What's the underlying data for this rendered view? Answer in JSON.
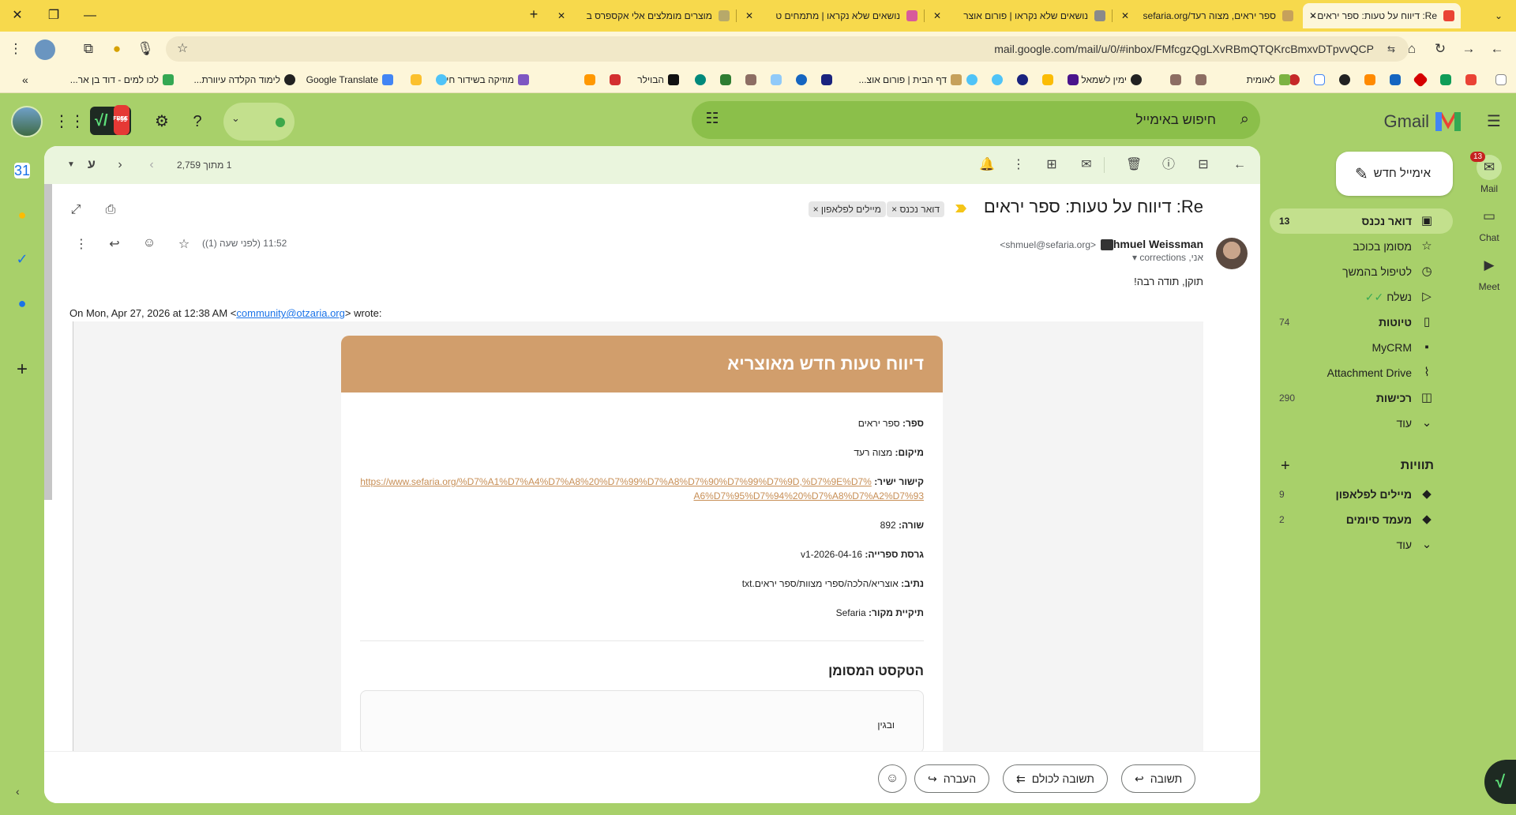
{
  "browser": {
    "tabs": [
      {
        "title": "Re: דיווח על טעות: ספר יראים -",
        "active": true
      },
      {
        "title": "ספר יראים, מצוה רעד/sefaria.org",
        "active": false
      },
      {
        "title": "נושאים שלא נקראו | פורום אוצר",
        "active": false
      },
      {
        "title": "נושאים שלא נקראו | מתמחים ט",
        "active": false
      },
      {
        "title": "מוצרים מומלצים אלי אקספרס ב",
        "active": false
      }
    ],
    "url": "mail.google.com/mail/u/0/#inbox/FMfcgzQgLXvRBmQTQKrcBmxvDTpvvQCP",
    "bookmarks": [
      {
        "label": "לאומית"
      },
      {
        "label": "ימין לשמאל"
      },
      {
        "label": "דף הבית | פורום אוצ..."
      },
      {
        "label": "הבוילר"
      },
      {
        "label": "מוזיקה בשידור חי"
      },
      {
        "label": "Google Translate"
      },
      {
        "label": "לימוד הקלדה עיוורת..."
      },
      {
        "label": "לכו למים - דוד בן אר..."
      }
    ]
  },
  "gmail": {
    "logo_text": "Gmail",
    "search_placeholder": "חיפוש באימייל",
    "extension_badge": "+99",
    "extension_free": "FREE",
    "compose_label": "אימייל חדש",
    "nav": [
      {
        "label": "דואר נכנס",
        "count": "13",
        "icon": "inbox-icon",
        "active": true
      },
      {
        "label": "מסומן בכוכב",
        "count": "",
        "icon": "star-icon"
      },
      {
        "label": "לטיפול בהמשך",
        "count": "",
        "icon": "clock-icon"
      },
      {
        "label": "נשלח",
        "count": "",
        "icon": "send-icon"
      },
      {
        "label": "טיוטות",
        "count": "74",
        "icon": "draft-icon",
        "bold": true
      },
      {
        "label": "MyCRM",
        "count": "",
        "icon": "contact-card-icon"
      },
      {
        "label": "Attachment Drive",
        "count": "",
        "icon": "paperclip-icon"
      },
      {
        "label": "רכישות",
        "count": "290",
        "icon": "shopping-bag-icon",
        "bold": true
      },
      {
        "label": "עוד",
        "count": "",
        "icon": "chevron-down-icon"
      }
    ],
    "labels_heading": "תוויות",
    "labels": [
      {
        "label": "מיילים לפלאפון",
        "count": "9"
      },
      {
        "label": "מעמד סיומים",
        "count": "2"
      },
      {
        "label": "עוד",
        "count": ""
      }
    ],
    "rail": {
      "mail_label": "Mail",
      "mail_badge": "13",
      "chat_label": "Chat",
      "meet_label": "Meet"
    }
  },
  "thread": {
    "count_text": "1 מתוך 2,759",
    "lang_toggle": "ע",
    "subject": "Re: דיווח על טעות: ספר יראים",
    "chips": [
      "דואר נכנס",
      "מיילים לפלאפון"
    ],
    "sender_name": "Shmuel Weissman",
    "sender_email": "<shmuel@sefaria.org>",
    "recipients": "אני, corrections",
    "time": "11:52 (לפני שעה (1))",
    "body": "תוקן, תודה רבה!",
    "quote_prefix": "On Mon, Apr 27, 2026 at 12:38 AM <",
    "quote_email": "community@otzaria.org",
    "quote_suffix": "> wrote:"
  },
  "report": {
    "title": "דיווח טעות חדש מאוצריא",
    "fields": [
      {
        "label": "ספר:",
        "value": "ספר יראים"
      },
      {
        "label": "מיקום:",
        "value": "מצוה רעד"
      },
      {
        "label": "קישור ישיר:",
        "value": "https://www.sefaria.org/%D7%A1%D7%A4%D7%A8%20%D7%99%D7%A8%D7%90%D7%99%D7%9D,%D7%9E%D7%A6%D7%95%D7%94%20%D7%A8%D7%A2%D7%93"
      },
      {
        "label": "שורה:",
        "value": "892"
      },
      {
        "label": "גרסת ספרייה:",
        "value": "v1-2026-04-16"
      },
      {
        "label": "נתיב:",
        "value": "אוצריא/הלכה/ספרי מצוות/ספר יראים.txt"
      },
      {
        "label": "תיקיית מקור:",
        "value": "Sefaria"
      }
    ],
    "marked_heading": "הטקסט המסומן",
    "marked_text": "ובגין"
  },
  "reply_bar": {
    "reply": "תשובה",
    "reply_all": "תשובה לכולם",
    "forward": "העברה"
  }
}
